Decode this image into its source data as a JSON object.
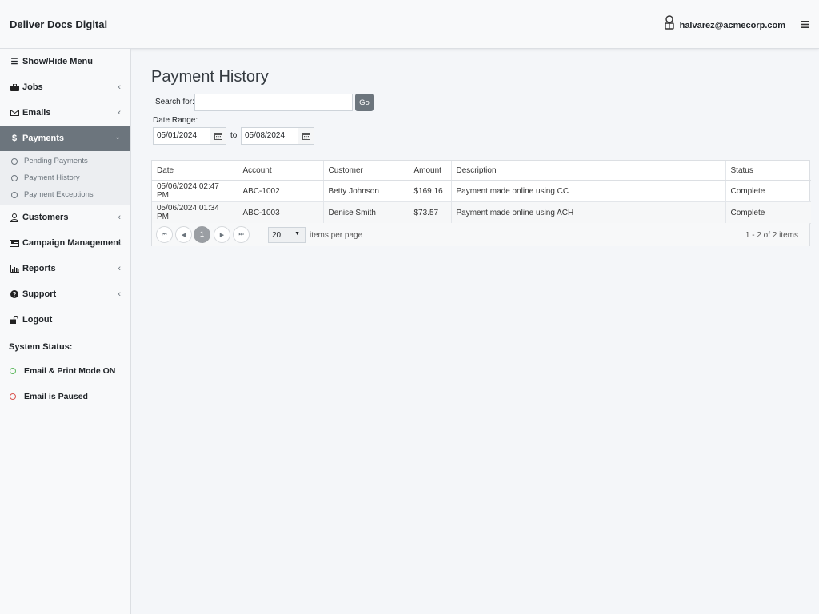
{
  "header": {
    "brand": "Deliver Docs Digital",
    "user_email": "halvarez@acmecorp.com"
  },
  "sidebar": {
    "items": [
      {
        "label": "Show/Hide Menu",
        "icon": "menu-icon"
      },
      {
        "label": "Jobs",
        "icon": "briefcase-icon"
      },
      {
        "label": "Emails",
        "icon": "envelope-icon"
      },
      {
        "label": "Payments",
        "icon": "dollar-icon"
      },
      {
        "label": "Customers",
        "icon": "user-icon"
      },
      {
        "label": "Campaign Management",
        "icon": "newspaper-icon"
      },
      {
        "label": "Reports",
        "icon": "bar-chart-icon"
      },
      {
        "label": "Support",
        "icon": "question-circle-icon"
      },
      {
        "label": "Logout",
        "icon": "unlock-icon"
      }
    ],
    "payments_sub": [
      "Pending Payments",
      "Payment History",
      "Payment Exceptions"
    ],
    "system_status_title": "System Status:",
    "status_items": [
      {
        "label": "Email & Print Mode ON",
        "color": "#5cb85c"
      },
      {
        "label": "Email is Paused",
        "color": "#d9534f"
      }
    ]
  },
  "main": {
    "title": "Payment History",
    "search_label": "Search for:",
    "search_value": "",
    "go_label": "Go",
    "date_range_label": "Date Range:",
    "date_from": "05/01/2024",
    "to_label": "to",
    "date_to": "05/08/2024"
  },
  "grid": {
    "columns": [
      "Date",
      "Account",
      "Customer",
      "Amount",
      "Description",
      "Status"
    ],
    "rows": [
      [
        "05/06/2024 02:47 PM",
        "ABC-1002",
        "Betty Johnson",
        "$169.16",
        "Payment made online using CC",
        "Complete"
      ],
      [
        "05/06/2024 01:34 PM",
        "ABC-1003",
        "Denise Smith",
        "$73.57",
        "Payment made online using ACH",
        "Complete"
      ]
    ],
    "pager": {
      "current_page": "1",
      "page_size": "20",
      "items_per_page_label": "items per page",
      "info": "1 - 2 of 2 items"
    }
  },
  "colors": {
    "active_nav": "#6c757d",
    "status_on": "#5cb85c",
    "status_paused": "#d9534f"
  }
}
